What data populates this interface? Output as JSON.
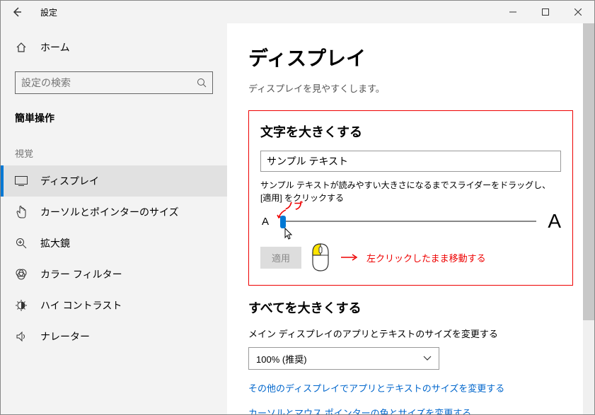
{
  "titlebar": {
    "title": "設定"
  },
  "sidebar": {
    "home": "ホーム",
    "search_placeholder": "設定の検索",
    "top_header": "簡単操作",
    "group_label": "視覚",
    "items": [
      {
        "label": "ディスプレイ"
      },
      {
        "label": "カーソルとポインターのサイズ"
      },
      {
        "label": "拡大鏡"
      },
      {
        "label": "カラー フィルター"
      },
      {
        "label": "ハイ コントラスト"
      },
      {
        "label": "ナレーター"
      }
    ]
  },
  "content": {
    "h1": "ディスプレイ",
    "subtitle": "ディスプレイを見やすくします。",
    "text_bigger": {
      "heading": "文字を大きくする",
      "sample_value": "サンプル テキスト",
      "hint": "サンプル テキストが読みやすい大きさになるまでスライダーをドラッグし、[適用] をクリックする",
      "smallA": "A",
      "bigA": "A",
      "apply": "適用",
      "annotation_knob": "ノブ",
      "annotation_drag": "左クリックしたまま移動する"
    },
    "everything_bigger": {
      "heading": "すべてを大きくする",
      "label": "メイン ディスプレイのアプリとテキストのサイズを変更する",
      "select_value": "100% (推奨)",
      "link1": "その他のディスプレイでアプリとテキストのサイズを変更する",
      "link2": "カーソルとマウス ポインターの色とサイズを変更する"
    }
  }
}
